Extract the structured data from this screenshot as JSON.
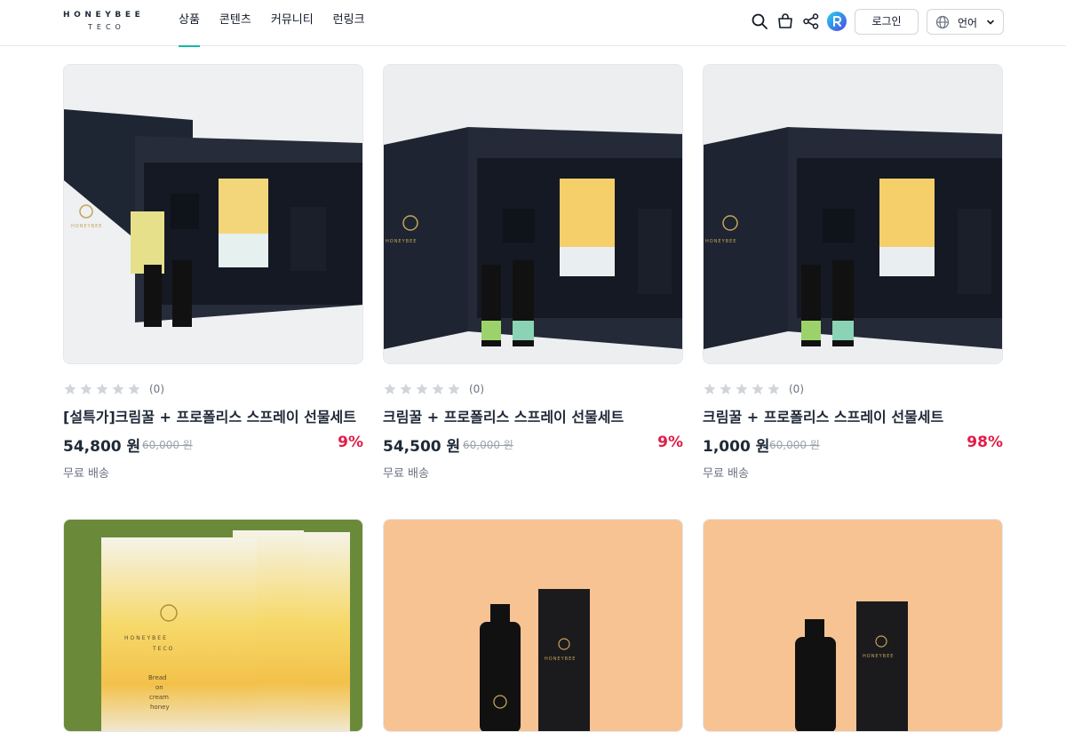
{
  "brand": {
    "line1": "HONEYBEE",
    "line2": "TECO"
  },
  "nav": [
    {
      "label": "상품",
      "active": true
    },
    {
      "label": "콘텐츠"
    },
    {
      "label": "커뮤니티"
    },
    {
      "label": "런링크"
    }
  ],
  "header": {
    "login_label": "로그인",
    "language_label": "언어"
  },
  "icons": [
    "search-icon",
    "cart-icon",
    "share-icon",
    "app-r-icon",
    "globe-icon",
    "chevron-down-icon"
  ],
  "colors": {
    "accent": "#14b8a6",
    "discount": "#e11d48",
    "text": "#1f2937",
    "muted": "#6b7280"
  },
  "products": [
    {
      "name": "[설특가]크림꿀 + 프로폴리스 스프레이 선물세트",
      "rating_count": "(0)",
      "price": "54,800 원",
      "original_price": "60,000 원",
      "discount": "9%",
      "shipping": "무료 배송"
    },
    {
      "name": "크림꿀 + 프로폴리스 스프레이 선물세트",
      "rating_count": "(0)",
      "price": "54,500 원",
      "original_price": "60,000 원",
      "discount": "9%",
      "shipping": "무료 배송"
    },
    {
      "name": "크림꿀 + 프로폴리스 스프레이 선물세트",
      "rating_count": "(0)",
      "price": "1,000 원",
      "original_price": "60,000 원",
      "discount": "98%",
      "shipping": "무료 배송"
    },
    {
      "name": "",
      "rating_count": "",
      "price": "",
      "original_price": "",
      "discount": "",
      "shipping": ""
    },
    {
      "name": "",
      "rating_count": "",
      "price": "",
      "original_price": "",
      "discount": "",
      "shipping": ""
    },
    {
      "name": "",
      "rating_count": "",
      "price": "",
      "original_price": "",
      "discount": "",
      "shipping": ""
    }
  ],
  "image_text": {
    "brand_small": "HONEYBEE",
    "brand_sub": "TECO",
    "pack_text": [
      "Bread",
      "on",
      "cream",
      "honey"
    ]
  }
}
